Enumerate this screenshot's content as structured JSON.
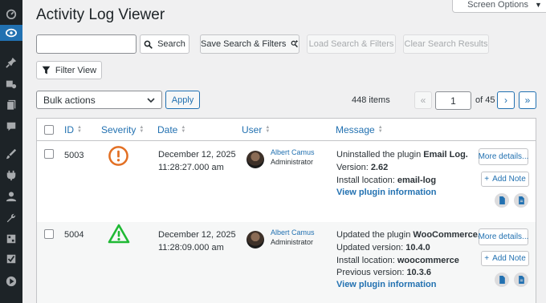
{
  "sidebar": {
    "items": [
      {
        "icon": "dashboard-icon"
      },
      {
        "icon": "activity-log-icon",
        "active": true
      },
      {
        "icon": "pin-icon"
      },
      {
        "icon": "media-icon"
      },
      {
        "icon": "pages-icon"
      },
      {
        "icon": "comments-icon"
      },
      {
        "icon": "appearance-icon"
      },
      {
        "icon": "plugins-icon"
      },
      {
        "icon": "users-icon"
      },
      {
        "icon": "tools-icon"
      },
      {
        "icon": "settings-icon"
      },
      {
        "icon": "checklist-icon"
      },
      {
        "icon": "play-icon"
      }
    ]
  },
  "header": {
    "title": "Activity Log Viewer",
    "screen_options": "Screen Options"
  },
  "search": {
    "value": "",
    "button": "Search",
    "save_button": "Save Search & Filters",
    "load_button": "Load Search & Filters",
    "clear_button": "Clear Search Results",
    "filter_button": "Filter View"
  },
  "bulk": {
    "selected": "Bulk actions",
    "apply": "Apply"
  },
  "pagination": {
    "items_count": "448 items",
    "first": "«",
    "prev": "‹",
    "current_page": "1",
    "of_total": "of 45",
    "next": "›",
    "last": "»"
  },
  "table": {
    "columns": [
      "ID",
      "Severity",
      "Date",
      "User",
      "Message"
    ],
    "rows": [
      {
        "id": "5003",
        "severity": "warning",
        "date_line1": "December 12, 2025",
        "date_line2": "11:28:27.000 am",
        "user_name": "Albert Camus",
        "user_role": "Administrator",
        "msg1_pre": "Uninstalled the plugin ",
        "msg1_bold": "Email Log.",
        "msg2_pre": "Version: ",
        "msg2_bold": "2.62",
        "msg3_pre": "Install location: ",
        "msg3_bold": "email-log",
        "msg4_pre": "",
        "msg4_bold": "",
        "link": "View plugin information",
        "more_details": "More details...",
        "add_note": "Add Note"
      },
      {
        "id": "5004",
        "severity": "info",
        "date_line1": "December 12, 2025",
        "date_line2": "11:28:09.000 am",
        "user_name": "Albert Camus",
        "user_role": "Administrator",
        "msg1_pre": "Updated the plugin ",
        "msg1_bold": "WooCommerce.",
        "msg2_pre": "Updated version: ",
        "msg2_bold": "10.4.0",
        "msg3_pre": "Install location: ",
        "msg3_bold": "woocommerce",
        "msg4_pre": "Previous version: ",
        "msg4_bold": "10.3.6",
        "link": "View plugin information",
        "more_details": "More details...",
        "add_note": "Add Note"
      }
    ]
  },
  "colors": {
    "accent": "#2271b1",
    "warning": "#e26f23",
    "info": "#1fb934",
    "sidebar_bg": "#1d2327"
  }
}
